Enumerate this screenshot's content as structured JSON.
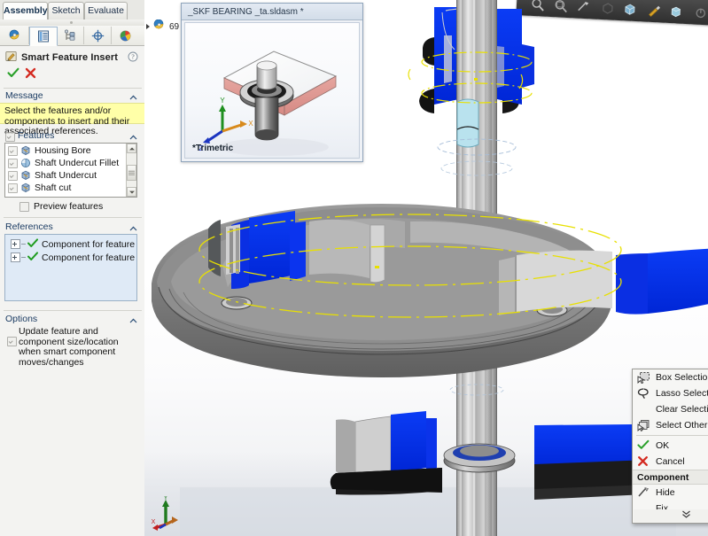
{
  "command_tabs": [
    {
      "label": "Assembly",
      "active": true
    },
    {
      "label": "Sketch",
      "active": false
    },
    {
      "label": "Evaluate",
      "active": false
    }
  ],
  "panel_tabs": [
    {
      "name": "feature-manager-tree-tab",
      "selected": false
    },
    {
      "name": "property-manager-tab",
      "selected": true
    },
    {
      "name": "configuration-manager-tab",
      "selected": false
    },
    {
      "name": "dimxpert-manager-tab",
      "selected": false
    },
    {
      "name": "display-manager-tab",
      "selected": false
    }
  ],
  "property_manager": {
    "title": "Smart Feature Insert",
    "icon": "smart-feature-insert-icon",
    "help_icon": "help-question-icon",
    "accept_icon": "green-check-icon",
    "cancel_icon": "red-x-icon"
  },
  "message": {
    "header": "Message",
    "text": "Select the features and/or components to insert and their associated references.",
    "background": "#ffffa8"
  },
  "features": {
    "header": "Features",
    "header_checkbox_checked": true,
    "items": [
      {
        "label": "Housing Bore",
        "checked": true,
        "icon": "feature-cut-icon"
      },
      {
        "label": "Shaft Undercut Fillet",
        "checked": true,
        "icon": "feature-fillet-icon"
      },
      {
        "label": "Shaft Undercut",
        "checked": true,
        "icon": "feature-cut-icon"
      },
      {
        "label": "Shaft cut",
        "checked": true,
        "icon": "feature-cut-icon"
      }
    ],
    "preview_label": "Preview features",
    "preview_checked": false
  },
  "references": {
    "header": "References",
    "items": [
      {
        "label": "Component for feature",
        "status_icon": "green-check-icon",
        "expandable": true
      },
      {
        "label": "Component for feature",
        "status_icon": "green-check-icon",
        "expandable": true
      }
    ]
  },
  "options": {
    "header": "Options",
    "checkbox_checked": true,
    "text": "Update feature and component size/location when smart component moves/changes"
  },
  "viewport": {
    "tree_stub_label": "69",
    "tree_stub_icon": "assembly-doc-icon",
    "triad": {
      "x_label": "X",
      "y_label": "Y",
      "z_label": "Z"
    },
    "hud_icons": [
      "zoom-to-fit-icon",
      "zoom-to-area-icon",
      "section-view-icon",
      "view-orientation-icon",
      "display-style-icon",
      "hide-show-icon",
      "appearances-icon",
      "scene-icon",
      "view-settings-icon"
    ]
  },
  "preview_window": {
    "title": "_SKF BEARING _ta.sldasm *",
    "view_label": "*Trimetric"
  },
  "context_menu": {
    "items": [
      {
        "label": "Box Selection",
        "icon": "box-selection-icon",
        "type": "item"
      },
      {
        "label": "Lasso Selection",
        "icon": "lasso-selection-icon",
        "type": "item"
      },
      {
        "label": "Clear Selections",
        "icon": "none",
        "type": "item"
      },
      {
        "label": "Select Other",
        "icon": "select-other-icon",
        "type": "item"
      },
      {
        "type": "separator"
      },
      {
        "label": "OK",
        "icon": "green-check-icon",
        "type": "item"
      },
      {
        "label": "Cancel",
        "icon": "red-x-icon",
        "type": "item"
      },
      {
        "label": "Component",
        "type": "header"
      },
      {
        "label": "Hide",
        "icon": "hide-component-icon",
        "type": "item"
      },
      {
        "label": "Fix",
        "icon": "none",
        "type": "item"
      }
    ],
    "expand_icon": "double-chevron-down-icon"
  },
  "colors": {
    "selected_face": "#0030ef",
    "highlight_face": "#b9e2ee",
    "construction_line": "#e8e000",
    "panel_bg": "#f3f3f1",
    "message_bg": "#ffffa8",
    "reference_box_bg": "#dfeaf6"
  }
}
